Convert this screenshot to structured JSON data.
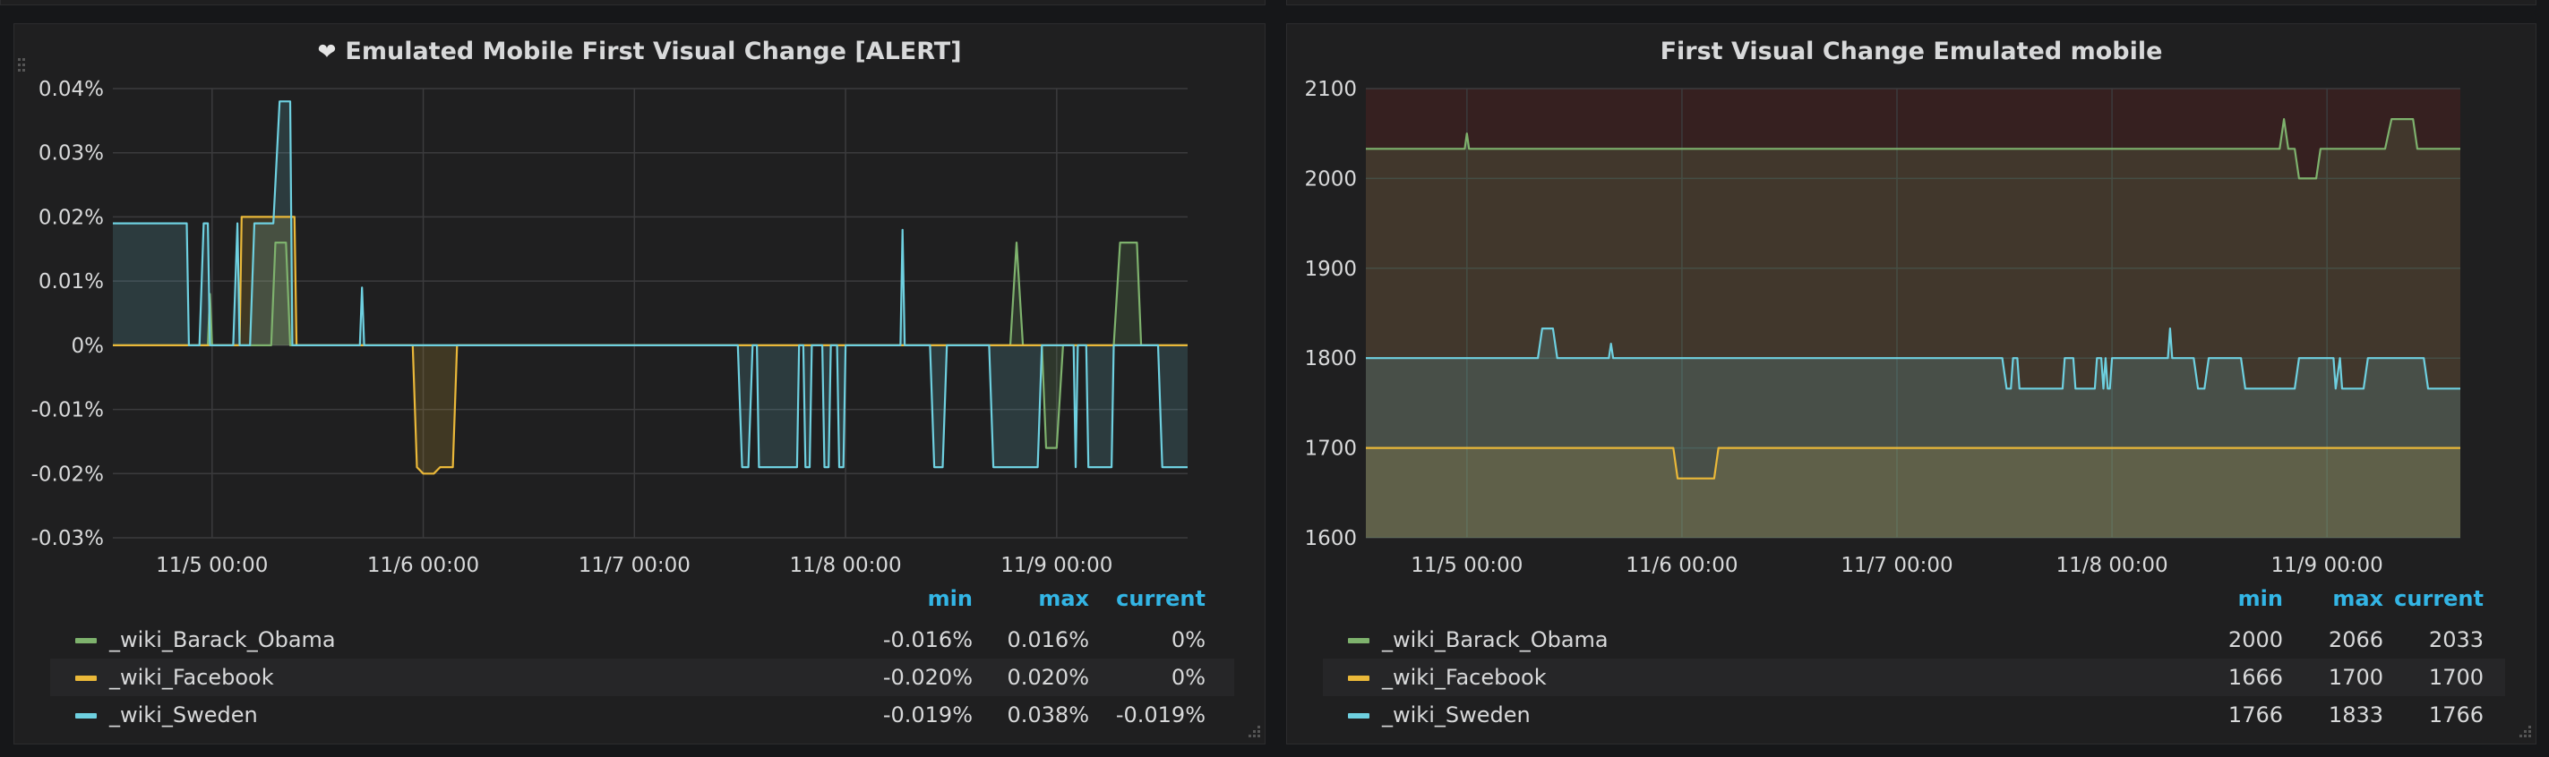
{
  "panels": [
    {
      "title": "Emulated Mobile First Visual Change [ALERT]",
      "alert_icon": "heart-icon",
      "legend": {
        "headers": [
          "min",
          "max",
          "current"
        ],
        "rows": [
          {
            "name": "_wiki_Barack_Obama",
            "min": "-0.016%",
            "max": "0.016%",
            "current": "0%"
          },
          {
            "name": "_wiki_Facebook",
            "min": "-0.020%",
            "max": "0.020%",
            "current": "0%"
          },
          {
            "name": "_wiki_Sweden",
            "min": "-0.019%",
            "max": "0.038%",
            "current": "-0.019%"
          }
        ]
      }
    },
    {
      "title": "First Visual Change Emulated mobile",
      "legend": {
        "headers": [
          "min",
          "max",
          "current"
        ],
        "rows": [
          {
            "name": "_wiki_Barack_Obama",
            "min": "2000",
            "max": "2066",
            "current": "2033"
          },
          {
            "name": "_wiki_Facebook",
            "min": "1666",
            "max": "1700",
            "current": "1700"
          },
          {
            "name": "_wiki_Sweden",
            "min": "1766",
            "max": "1833",
            "current": "1766"
          }
        ]
      }
    }
  ],
  "colors": {
    "_wiki_Barack_Obama": "#7eb26d",
    "_wiki_Facebook": "#eab839",
    "_wiki_Sweden": "#6ed0e0",
    "legend_header": "#33b5e5",
    "threshold_fill": "#5c2323"
  },
  "chart_data": [
    {
      "type": "area",
      "title": "Emulated Mobile First Visual Change [ALERT]",
      "x_unit": "days since 11/4 00:00",
      "xlim": [
        0.53,
        5.62
      ],
      "ylim": [
        -0.03,
        0.04
      ],
      "y_unit": "%",
      "xticks": [
        {
          "x": 1,
          "label": "11/5 00:00"
        },
        {
          "x": 2,
          "label": "11/6 00:00"
        },
        {
          "x": 3,
          "label": "11/7 00:00"
        },
        {
          "x": 4,
          "label": "11/8 00:00"
        },
        {
          "x": 5,
          "label": "11/9 00:00"
        }
      ],
      "yticks": [
        {
          "y": 0.04,
          "label": "0.04%"
        },
        {
          "y": 0.03,
          "label": "0.03%"
        },
        {
          "y": 0.02,
          "label": "0.02%"
        },
        {
          "y": 0.01,
          "label": "0.01%"
        },
        {
          "y": 0,
          "label": "0%"
        },
        {
          "y": -0.01,
          "label": "-0.01%"
        },
        {
          "y": -0.02,
          "label": "-0.02%"
        },
        {
          "y": -0.03,
          "label": "-0.03%"
        }
      ],
      "grid": true,
      "series": [
        {
          "name": "_wiki_Barack_Obama",
          "points": [
            [
              0.53,
              0
            ],
            [
              0.98,
              0
            ],
            [
              0.99,
              0.008
            ],
            [
              1.0,
              0
            ],
            [
              1.28,
              0
            ],
            [
              1.3,
              0.016
            ],
            [
              1.35,
              0.016
            ],
            [
              1.37,
              0
            ],
            [
              4.78,
              0
            ],
            [
              4.81,
              0.016
            ],
            [
              4.84,
              0
            ],
            [
              4.93,
              0
            ],
            [
              4.95,
              -0.016
            ],
            [
              5.0,
              -0.016
            ],
            [
              5.03,
              0
            ],
            [
              5.27,
              0
            ],
            [
              5.3,
              0.016
            ],
            [
              5.38,
              0.016
            ],
            [
              5.4,
              0
            ],
            [
              5.62,
              0
            ]
          ]
        },
        {
          "name": "_wiki_Facebook",
          "points": [
            [
              0.53,
              0
            ],
            [
              1.13,
              0
            ],
            [
              1.14,
              0.02
            ],
            [
              1.39,
              0.02
            ],
            [
              1.4,
              0
            ],
            [
              1.95,
              0
            ],
            [
              1.97,
              -0.019
            ],
            [
              2.0,
              -0.02
            ],
            [
              2.05,
              -0.02
            ],
            [
              2.08,
              -0.019
            ],
            [
              2.14,
              -0.019
            ],
            [
              2.16,
              0
            ],
            [
              5.62,
              0
            ]
          ]
        },
        {
          "name": "_wiki_Sweden",
          "points": [
            [
              0.53,
              0.019
            ],
            [
              0.88,
              0.019
            ],
            [
              0.89,
              0
            ],
            [
              0.94,
              0
            ],
            [
              0.96,
              0.019
            ],
            [
              0.98,
              0.019
            ],
            [
              0.99,
              0
            ],
            [
              1.1,
              0
            ],
            [
              1.12,
              0.019
            ],
            [
              1.13,
              0
            ],
            [
              1.18,
              0
            ],
            [
              1.2,
              0.019
            ],
            [
              1.29,
              0.019
            ],
            [
              1.32,
              0.038
            ],
            [
              1.37,
              0.038
            ],
            [
              1.38,
              0
            ],
            [
              1.7,
              0
            ],
            [
              1.71,
              0.009
            ],
            [
              1.72,
              0
            ],
            [
              3.49,
              0
            ],
            [
              3.51,
              -0.019
            ],
            [
              3.54,
              -0.019
            ],
            [
              3.56,
              0
            ],
            [
              3.58,
              0
            ],
            [
              3.59,
              -0.019
            ],
            [
              3.77,
              -0.019
            ],
            [
              3.78,
              0
            ],
            [
              3.8,
              0
            ],
            [
              3.81,
              -0.019
            ],
            [
              3.83,
              -0.019
            ],
            [
              3.84,
              0
            ],
            [
              3.89,
              0
            ],
            [
              3.9,
              -0.019
            ],
            [
              3.92,
              -0.019
            ],
            [
              3.93,
              0
            ],
            [
              3.96,
              0
            ],
            [
              3.97,
              -0.019
            ],
            [
              3.99,
              -0.019
            ],
            [
              4.0,
              0
            ],
            [
              4.26,
              0
            ],
            [
              4.27,
              0.018
            ],
            [
              4.28,
              0
            ],
            [
              4.4,
              0
            ],
            [
              4.42,
              -0.019
            ],
            [
              4.46,
              -0.019
            ],
            [
              4.48,
              0
            ],
            [
              4.68,
              0
            ],
            [
              4.7,
              -0.019
            ],
            [
              4.91,
              -0.019
            ],
            [
              4.93,
              0
            ],
            [
              5.08,
              0
            ],
            [
              5.09,
              -0.019
            ],
            [
              5.1,
              0
            ],
            [
              5.14,
              0
            ],
            [
              5.15,
              -0.019
            ],
            [
              5.26,
              -0.019
            ],
            [
              5.27,
              0
            ],
            [
              5.48,
              0
            ],
            [
              5.5,
              -0.019
            ],
            [
              5.62,
              -0.019
            ]
          ]
        }
      ]
    },
    {
      "type": "area",
      "title": "First Visual Change Emulated mobile",
      "x_unit": "days since 11/4 00:00",
      "xlim": [
        0.53,
        5.62
      ],
      "ylim": [
        1600,
        2100
      ],
      "xticks": [
        {
          "x": 1,
          "label": "11/5 00:00"
        },
        {
          "x": 2,
          "label": "11/6 00:00"
        },
        {
          "x": 3,
          "label": "11/7 00:00"
        },
        {
          "x": 4,
          "label": "11/8 00:00"
        },
        {
          "x": 5,
          "label": "11/9 00:00"
        }
      ],
      "yticks": [
        {
          "y": 2100,
          "label": "2100"
        },
        {
          "y": 2000,
          "label": "2000"
        },
        {
          "y": 1900,
          "label": "1900"
        },
        {
          "y": 1800,
          "label": "1800"
        },
        {
          "y": 1700,
          "label": "1700"
        },
        {
          "y": 1600,
          "label": "1600"
        }
      ],
      "grid": true,
      "threshold_region": [
        1600,
        2100
      ],
      "series": [
        {
          "name": "_wiki_Barack_Obama",
          "points": [
            [
              0.53,
              2033
            ],
            [
              0.99,
              2033
            ],
            [
              1.0,
              2050
            ],
            [
              1.01,
              2033
            ],
            [
              4.78,
              2033
            ],
            [
              4.8,
              2066
            ],
            [
              4.82,
              2033
            ],
            [
              4.85,
              2033
            ],
            [
              4.87,
              2000
            ],
            [
              4.95,
              2000
            ],
            [
              4.97,
              2033
            ],
            [
              5.27,
              2033
            ],
            [
              5.3,
              2066
            ],
            [
              5.4,
              2066
            ],
            [
              5.42,
              2033
            ],
            [
              5.62,
              2033
            ]
          ]
        },
        {
          "name": "_wiki_Facebook",
          "points": [
            [
              0.53,
              1700
            ],
            [
              1.96,
              1700
            ],
            [
              1.98,
              1666
            ],
            [
              2.15,
              1666
            ],
            [
              2.17,
              1700
            ],
            [
              5.62,
              1700
            ]
          ]
        },
        {
          "name": "_wiki_Sweden",
          "points": [
            [
              0.53,
              1800
            ],
            [
              1.33,
              1800
            ],
            [
              1.35,
              1833
            ],
            [
              1.4,
              1833
            ],
            [
              1.42,
              1800
            ],
            [
              1.66,
              1800
            ],
            [
              1.67,
              1816
            ],
            [
              1.68,
              1800
            ],
            [
              3.49,
              1800
            ],
            [
              3.51,
              1766
            ],
            [
              3.53,
              1766
            ],
            [
              3.54,
              1800
            ],
            [
              3.56,
              1800
            ],
            [
              3.57,
              1766
            ],
            [
              3.77,
              1766
            ],
            [
              3.78,
              1800
            ],
            [
              3.82,
              1800
            ],
            [
              3.83,
              1766
            ],
            [
              3.92,
              1766
            ],
            [
              3.93,
              1800
            ],
            [
              3.95,
              1800
            ],
            [
              3.96,
              1766
            ],
            [
              3.97,
              1800
            ],
            [
              3.98,
              1766
            ],
            [
              3.99,
              1766
            ],
            [
              4.0,
              1800
            ],
            [
              4.26,
              1800
            ],
            [
              4.27,
              1833
            ],
            [
              4.28,
              1800
            ],
            [
              4.38,
              1800
            ],
            [
              4.4,
              1766
            ],
            [
              4.43,
              1766
            ],
            [
              4.45,
              1800
            ],
            [
              4.6,
              1800
            ],
            [
              4.62,
              1766
            ],
            [
              4.85,
              1766
            ],
            [
              4.87,
              1800
            ],
            [
              5.03,
              1800
            ],
            [
              5.04,
              1766
            ],
            [
              5.06,
              1800
            ],
            [
              5.07,
              1766
            ],
            [
              5.17,
              1766
            ],
            [
              5.19,
              1800
            ],
            [
              5.45,
              1800
            ],
            [
              5.47,
              1766
            ],
            [
              5.62,
              1766
            ]
          ]
        }
      ]
    }
  ]
}
